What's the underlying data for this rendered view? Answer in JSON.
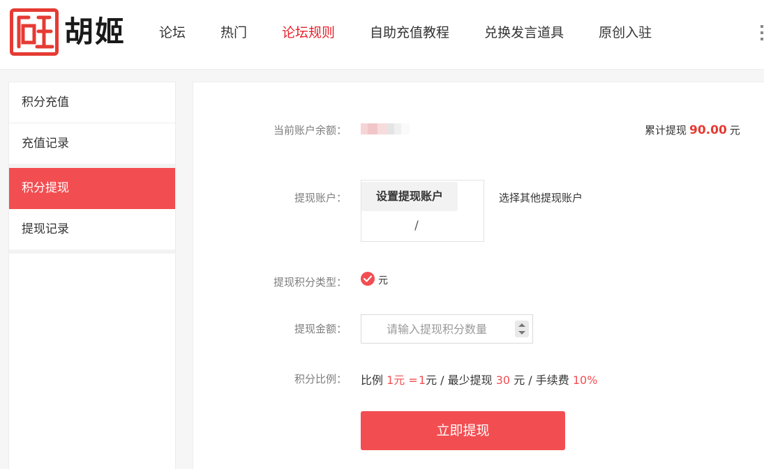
{
  "header": {
    "logo_text": "胡姬",
    "logo_seal_text": "胡姬",
    "nav": [
      {
        "label": "论坛",
        "active": false
      },
      {
        "label": "热门",
        "active": false
      },
      {
        "label": "论坛规则",
        "active": true
      },
      {
        "label": "自助充值教程",
        "active": false
      },
      {
        "label": "兑换发言道具",
        "active": false
      },
      {
        "label": "原创入驻",
        "active": false
      }
    ]
  },
  "sidebar": {
    "items": [
      {
        "label": "积分充值",
        "active": false
      },
      {
        "label": "充值记录",
        "active": false
      },
      {
        "label": "积分提现",
        "active": true
      },
      {
        "label": "提现记录",
        "active": false
      }
    ]
  },
  "main": {
    "balance_label": "当前账户余额：",
    "total_prefix": "累计提现",
    "total_value": "90.00",
    "total_unit": "元",
    "account_label": "提现账户：",
    "set_account_button": "设置提现账户",
    "account_value": "/",
    "other_account_link": "选择其他提现账户",
    "type_label": "提现积分类型：",
    "type_option": "元",
    "amount_label": "提现金额：",
    "amount_placeholder": "请输入提现积分数量",
    "ratio_label": "积分比例：",
    "ratio": {
      "prefix": "比例",
      "left": "1元",
      "equals": "=",
      "right_num": "1",
      "right_unit": "元 / 最少提现",
      "min_value": "30",
      "min_unit": "元 / 手续费",
      "fee": "10%"
    },
    "submit_button": "立即提现"
  },
  "colors": {
    "accent": "#f24e52",
    "nav_active": "#e7212b",
    "logo_red": "#e53b33"
  }
}
